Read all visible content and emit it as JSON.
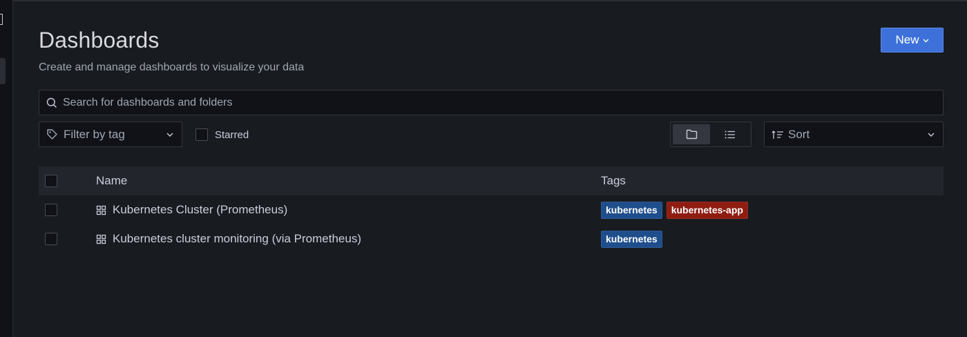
{
  "header": {
    "title": "Dashboards",
    "subtitle": "Create and manage dashboards to visualize your data",
    "new_button_label": "New"
  },
  "search": {
    "placeholder": "Search for dashboards and folders",
    "value": ""
  },
  "filters": {
    "tag_filter_placeholder": "Filter by tag",
    "starred_label": "Starred",
    "sort_placeholder": "Sort",
    "view_mode": "folder"
  },
  "table": {
    "columns": {
      "name": "Name",
      "tags": "Tags"
    },
    "rows": [
      {
        "name": "Kubernetes Cluster (Prometheus)",
        "tags": [
          {
            "label": "kubernetes",
            "color": "#1f4e8c"
          },
          {
            "label": "kubernetes-app",
            "color": "#8f1d12"
          }
        ]
      },
      {
        "name": "Kubernetes cluster monitoring (via Prometheus)",
        "tags": [
          {
            "label": "kubernetes",
            "color": "#1f4e8c"
          }
        ]
      }
    ]
  },
  "colors": {
    "primary": "#3d71d9",
    "background": "#181b1f",
    "tag_blue": "#1f4e8c",
    "tag_red": "#8f1d12"
  },
  "icons": {
    "search": "search-icon",
    "tag": "tag-icon",
    "folder_view": "folder-icon",
    "list_view": "list-icon",
    "sort": "sort-ascending-icon",
    "dashboard": "dashboard-grid-icon"
  }
}
